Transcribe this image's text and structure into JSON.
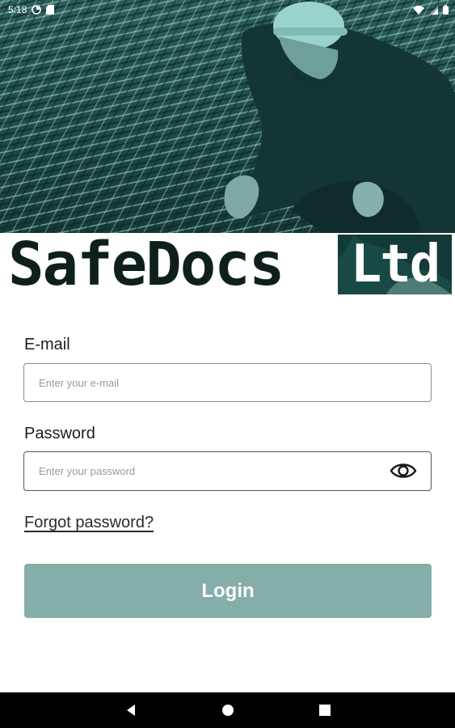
{
  "status_bar": {
    "time": "5:18",
    "icons": [
      "data-saver-icon",
      "sd-card-icon",
      "wifi-icon",
      "signal-icon",
      "battery-icon"
    ]
  },
  "hero": {
    "image": "construction-worker-rebar-photo",
    "tint_color": "#1e4a45"
  },
  "logo": {
    "part1": "SafeDocs",
    "part2": "Ltd",
    "text_color": "#0f1f1d",
    "box_color": "#123a36"
  },
  "form": {
    "email": {
      "label": "E-mail",
      "placeholder": "Enter your e-mail",
      "value": ""
    },
    "password": {
      "label": "Password",
      "placeholder": "Enter your password",
      "value": "",
      "toggle_icon": "eye-icon"
    },
    "forgot_label": "Forgot password?",
    "login_label": "Login",
    "login_color": "#85aea8"
  },
  "nav_bar": {
    "buttons": [
      "back-icon",
      "home-icon",
      "recents-icon"
    ]
  }
}
